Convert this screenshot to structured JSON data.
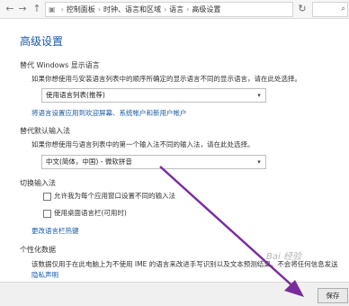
{
  "toolbar": {
    "back": "←",
    "forward": "→",
    "up": "↑",
    "breadcrumb": [
      "控制面板",
      "时钟、语言和区域",
      "语言",
      "高级设置"
    ],
    "refresh": "↻",
    "search_icon": "🔍"
  },
  "page": {
    "title": "高级设置",
    "display_lang": {
      "heading": "替代 Windows 显示语言",
      "desc": "如果你想使用与安装语言列表中的顺序所确定的显示语言不同的显示语言，请在此处选择。",
      "selected": "使用语言列表(推荐)",
      "link": "将语言设置应用到欢迎屏幕、系统帐户和新用户帐户"
    },
    "input_method": {
      "heading": "替代默认输入法",
      "desc": "如果你想使用与语言列表中的第一个输入法不同的输入法，请在此处选择。",
      "selected": "中文(简体，中国) - 微软拼音"
    },
    "switch": {
      "heading": "切换输入法",
      "option1": "允许我为每个应用窗口设置不同的输入法",
      "option2": "使用桌面语言栏(可用时)",
      "link": "更改语言栏热键"
    },
    "personal": {
      "heading": "个性化数据",
      "desc": "该数据仅用于在此电脑上为不使用 IME 的语言来改进手写识别以及文本预测结果。不会将任何信息发送",
      "link": "隐私声明"
    }
  },
  "footer": {
    "save": "保存"
  },
  "colors": {
    "accent": "#1a5aa8",
    "arrow": "#7b2c9c"
  }
}
